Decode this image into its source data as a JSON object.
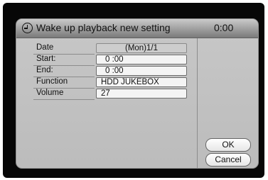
{
  "dialog": {
    "title": "Wake up playback new setting",
    "time": "0:00",
    "icon": "clock-icon"
  },
  "fields": [
    {
      "label": "Date",
      "value": "(Mon)1/1"
    },
    {
      "label": "Start:",
      "value": "0 :00"
    },
    {
      "label": "End:",
      "value": "0 :00"
    },
    {
      "label": "Function",
      "value": "HDD JUKEBOX"
    },
    {
      "label": "Volume",
      "value": "27"
    }
  ],
  "buttons": {
    "ok": "OK",
    "cancel": "Cancel"
  }
}
